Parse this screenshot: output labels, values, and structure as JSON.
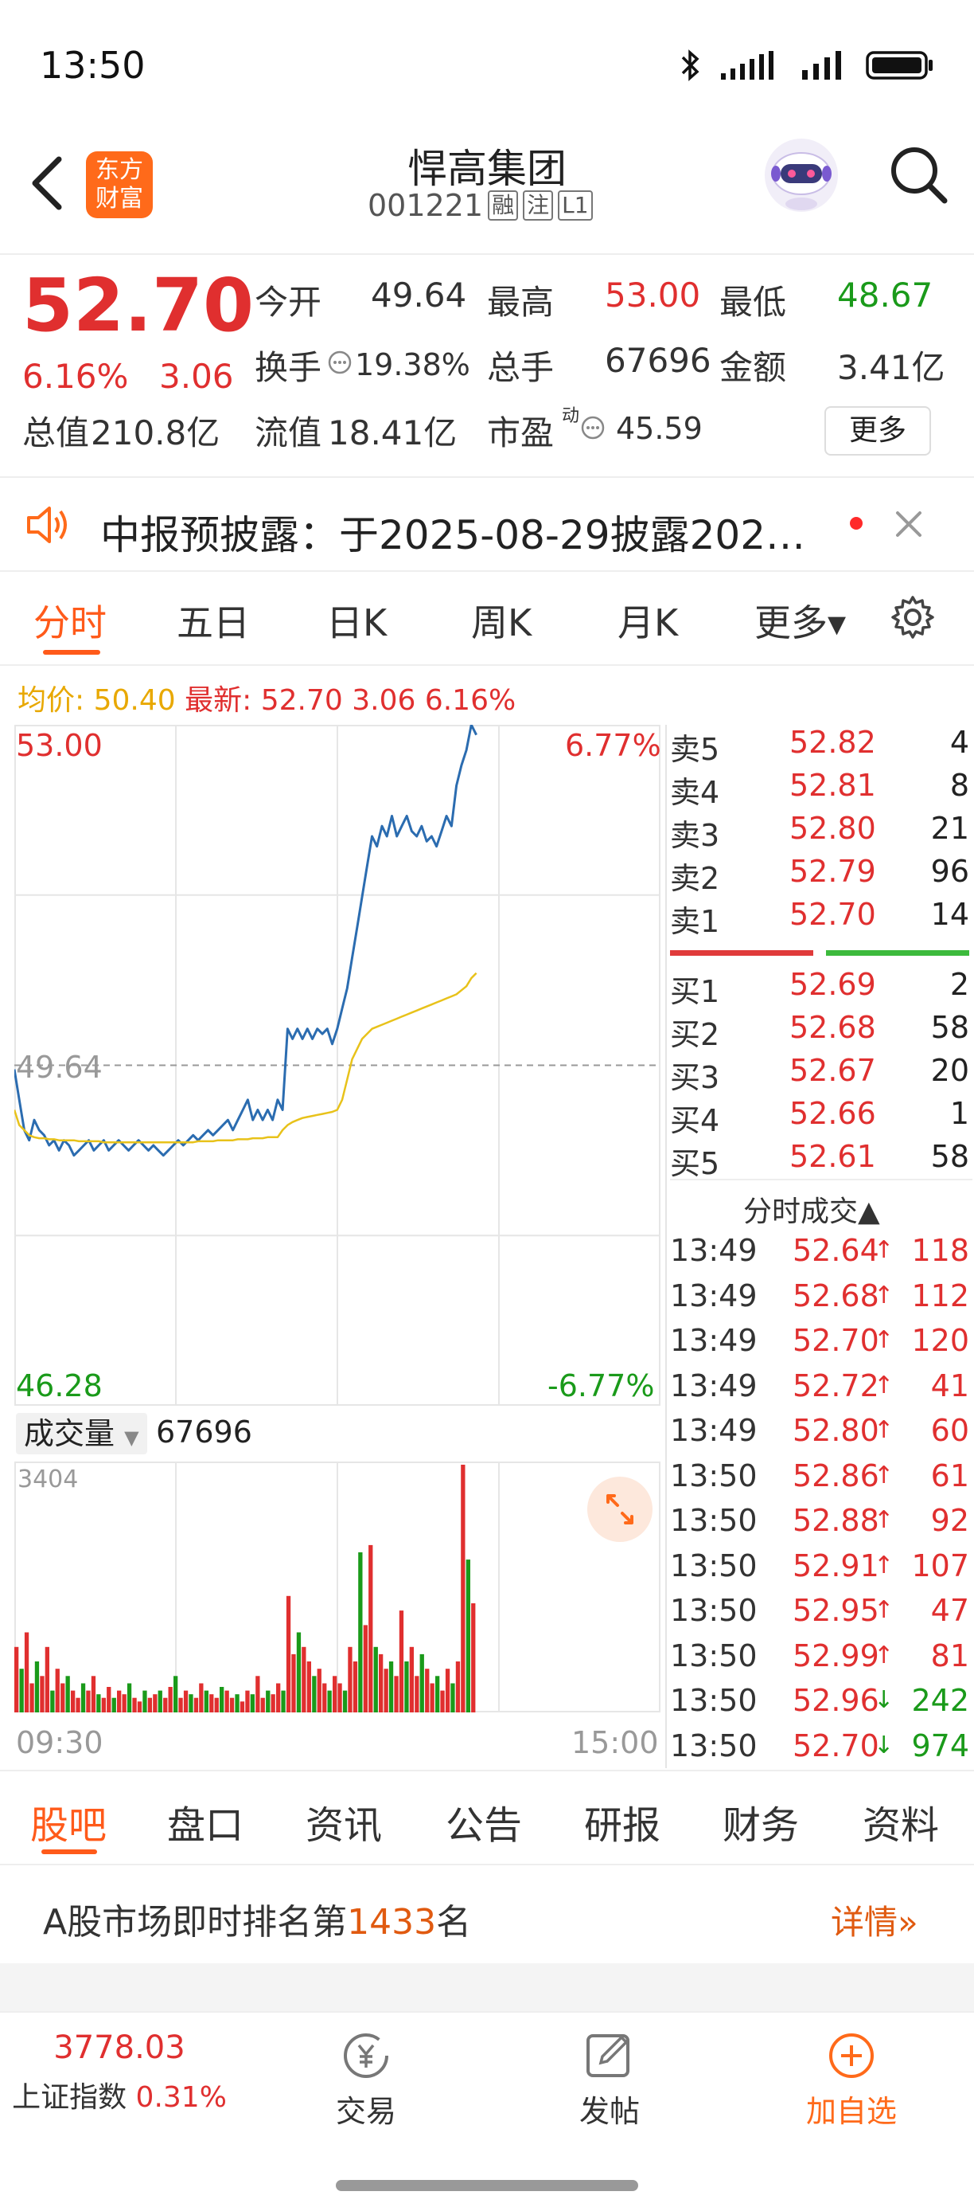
{
  "status_bar": {
    "time": "13:50"
  },
  "header": {
    "logo_line1": "东方",
    "logo_line2": "财富",
    "stock_name": "悍高集团",
    "stock_code": "001221",
    "tags": [
      "融",
      "注",
      "L1"
    ]
  },
  "quote": {
    "price": "52.70",
    "change_pct": "6.16%",
    "change_amt": "3.06",
    "stats": [
      {
        "label": "今开",
        "value": "49.64",
        "color": "#333333"
      },
      {
        "label": "最高",
        "value": "53.00",
        "color": "#e02f2f"
      },
      {
        "label": "最低",
        "value": "48.67",
        "color": "#1a9a1a"
      },
      {
        "label": "换手",
        "value": "19.38%",
        "color": "#333333"
      },
      {
        "label": "总手",
        "value": "67696",
        "color": "#333333"
      },
      {
        "label": "金额",
        "value": "3.41亿",
        "color": "#333333"
      }
    ],
    "market_cap_label": "总值",
    "market_cap": "210.8亿",
    "float_cap_label": "流值",
    "float_cap": "18.41亿",
    "pe_label": "市盈",
    "pe_superscript": "动",
    "pe_value": "45.59",
    "more_button": "更多"
  },
  "notice": {
    "text": "中报预披露：于2025-08-29披露202…"
  },
  "chart_tabs": [
    "分时",
    "五日",
    "日K",
    "周K",
    "月K",
    "更多▾"
  ],
  "avg_line": {
    "avg_label": "均价:",
    "avg_value": "50.40",
    "latest_label": "最新:",
    "latest_price": "52.70",
    "latest_chg": "3.06",
    "latest_pct": "6.16%"
  },
  "chart_data": {
    "type": "line",
    "title": "",
    "xlabel": "",
    "ylabel": "",
    "x_start": "09:30",
    "x_end": "15:00",
    "ylim": [
      46.28,
      53.0
    ],
    "y_top_label": "53.00",
    "y_bottom_label": "46.28",
    "y_mid_label": "49.64",
    "pct_top_label": "6.77%",
    "pct_bottom_label": "-6.77%",
    "series": [
      {
        "name": "",
        "color": "#2b6cb0",
        "values": [
          49.6,
          49.3,
          49.0,
          48.9,
          49.1,
          49.0,
          48.95,
          48.85,
          48.9,
          48.8,
          48.9,
          48.85,
          48.75,
          48.8,
          48.85,
          48.9,
          48.8,
          48.85,
          48.9,
          48.8,
          48.85,
          48.9,
          48.85,
          48.8,
          48.85,
          48.9,
          48.85,
          48.8,
          48.85,
          48.8,
          48.75,
          48.8,
          48.85,
          48.9,
          48.85,
          48.9,
          48.95,
          48.9,
          48.95,
          49.0,
          48.95,
          49.0,
          49.05,
          49.1,
          49.0,
          49.1,
          49.2,
          49.3,
          49.1,
          49.2,
          49.1,
          49.2,
          49.1,
          49.3,
          49.2,
          50.0,
          49.9,
          50.0,
          49.9,
          50.0,
          49.9,
          50.0,
          49.95,
          50.0,
          49.85,
          50.0,
          50.2,
          50.4,
          50.7,
          51.0,
          51.3,
          51.6,
          51.9,
          51.8,
          52.0,
          51.9,
          52.1,
          51.9,
          52.0,
          52.1,
          51.95,
          51.9,
          52.0,
          51.85,
          51.9,
          51.8,
          51.95,
          52.1,
          52.0,
          52.4,
          52.6,
          52.75,
          53.0,
          52.9
        ]
      },
      {
        "name": "均价",
        "color": "#e8c21a",
        "values": [
          49.2,
          49.05,
          49.0,
          48.95,
          48.93,
          48.92,
          48.92,
          48.91,
          48.91,
          48.9,
          48.9,
          48.9,
          48.9,
          48.89,
          48.89,
          48.89,
          48.89,
          48.89,
          48.88,
          48.88,
          48.88,
          48.88,
          48.88,
          48.88,
          48.88,
          48.88,
          48.88,
          48.88,
          48.88,
          48.88,
          48.88,
          48.88,
          48.88,
          48.88,
          48.88,
          48.88,
          48.88,
          48.89,
          48.89,
          48.89,
          48.89,
          48.9,
          48.9,
          48.9,
          48.9,
          48.91,
          48.91,
          48.91,
          48.92,
          48.92,
          48.92,
          48.93,
          48.93,
          48.93,
          49.0,
          49.05,
          49.08,
          49.1,
          49.12,
          49.13,
          49.14,
          49.15,
          49.16,
          49.17,
          49.18,
          49.2,
          49.3,
          49.5,
          49.7,
          49.8,
          49.9,
          49.95,
          50.0,
          50.02,
          50.04,
          50.06,
          50.08,
          50.1,
          50.12,
          50.14,
          50.16,
          50.18,
          50.2,
          50.22,
          50.24,
          50.26,
          50.28,
          50.3,
          50.32,
          50.34,
          50.38,
          50.42,
          50.5,
          50.55
        ]
      }
    ]
  },
  "volume": {
    "label": "成交量",
    "total": "67696",
    "max_label": "3404",
    "start_time": "09:30",
    "end_time": "15:00"
  },
  "volume_data": {
    "type": "bar",
    "ylim": [
      0,
      3404
    ],
    "values": [
      900,
      600,
      1100,
      400,
      700,
      500,
      900,
      300,
      600,
      400,
      500,
      300,
      200,
      400,
      300,
      500,
      250,
      200,
      350,
      200,
      300,
      250,
      400,
      200,
      150,
      300,
      200,
      250,
      300,
      200,
      350,
      500,
      200,
      300,
      250,
      200,
      400,
      300,
      250,
      200,
      350,
      300,
      200,
      250,
      150,
      300,
      250,
      500,
      200,
      300,
      250,
      400,
      300,
      1600,
      800,
      1100,
      900,
      700,
      500,
      600,
      400,
      300,
      500,
      400,
      300,
      900,
      700,
      2200,
      1200,
      2300,
      900,
      800,
      600,
      700,
      500,
      1400,
      700,
      900,
      500,
      800,
      600,
      400,
      500,
      300,
      600,
      400,
      700,
      3404,
      2100,
      1500
    ],
    "colors_up_down": [
      "#e02f2f",
      "#1a9a1a"
    ]
  },
  "order_book": {
    "asks": [
      {
        "label": "卖5",
        "price": "52.82",
        "qty": "4"
      },
      {
        "label": "卖4",
        "price": "52.81",
        "qty": "8"
      },
      {
        "label": "卖3",
        "price": "52.80",
        "qty": "21"
      },
      {
        "label": "卖2",
        "price": "52.79",
        "qty": "96"
      },
      {
        "label": "卖1",
        "price": "52.70",
        "qty": "14"
      }
    ],
    "bids": [
      {
        "label": "买1",
        "price": "52.69",
        "qty": "2"
      },
      {
        "label": "买2",
        "price": "52.68",
        "qty": "58"
      },
      {
        "label": "买3",
        "price": "52.67",
        "qty": "20"
      },
      {
        "label": "买4",
        "price": "52.66",
        "qty": "1"
      },
      {
        "label": "买5",
        "price": "52.61",
        "qty": "58"
      }
    ],
    "trades_title": "分时成交▲",
    "trades": [
      {
        "time": "13:49",
        "price": "52.64",
        "dir": "↑",
        "qty": "118",
        "up": true
      },
      {
        "time": "13:49",
        "price": "52.68",
        "dir": "↑",
        "qty": "112",
        "up": true
      },
      {
        "time": "13:49",
        "price": "52.70",
        "dir": "↑",
        "qty": "120",
        "up": true
      },
      {
        "time": "13:49",
        "price": "52.72",
        "dir": "↑",
        "qty": "41",
        "up": true
      },
      {
        "time": "13:49",
        "price": "52.80",
        "dir": "↑",
        "qty": "60",
        "up": true
      },
      {
        "time": "13:50",
        "price": "52.86",
        "dir": "↑",
        "qty": "61",
        "up": true
      },
      {
        "time": "13:50",
        "price": "52.88",
        "dir": "↑",
        "qty": "92",
        "up": true
      },
      {
        "time": "13:50",
        "price": "52.91",
        "dir": "↑",
        "qty": "107",
        "up": true
      },
      {
        "time": "13:50",
        "price": "52.95",
        "dir": "↑",
        "qty": "47",
        "up": true
      },
      {
        "time": "13:50",
        "price": "52.99",
        "dir": "↑",
        "qty": "81",
        "up": true
      },
      {
        "time": "13:50",
        "price": "52.96",
        "dir": "↓",
        "qty": "242",
        "up": false
      },
      {
        "time": "13:50",
        "price": "52.70",
        "dir": "↓",
        "qty": "974",
        "up": false
      }
    ]
  },
  "bottom_tabs": [
    "股吧",
    "盘口",
    "资讯",
    "公告",
    "研报",
    "财务",
    "资料"
  ],
  "rank": {
    "prefix": "A股市场即时排名第",
    "rank": "1433",
    "suffix": "名",
    "detail_link": "详情»"
  },
  "bottom_nav": {
    "index_value": "3778.03",
    "index_name": "上证指数",
    "index_pct": "0.31%",
    "trade_label": "交易",
    "post_label": "发帖",
    "watch_label": "加自选"
  }
}
